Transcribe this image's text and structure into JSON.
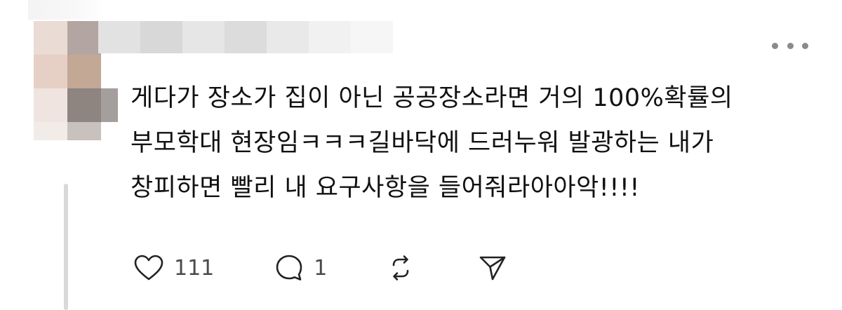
{
  "post": {
    "lines": [
      "게다가 장소가 집이 아닌 공공장소라면 거의 100%확률의",
      "부모학대 현장임ㅋㅋㅋ길바닥에 드러누워 발광하는 내가",
      "창피하면 빨리 내 요구사항을 들어줘라아아악!!!!"
    ]
  },
  "actions": {
    "like_icon": "heart-icon",
    "like_count": "111",
    "reply_icon": "comment-icon",
    "reply_count": "1",
    "repost_icon": "repost-icon",
    "share_icon": "send-icon"
  },
  "menu": {
    "icon": "more-horizontal-icon"
  }
}
